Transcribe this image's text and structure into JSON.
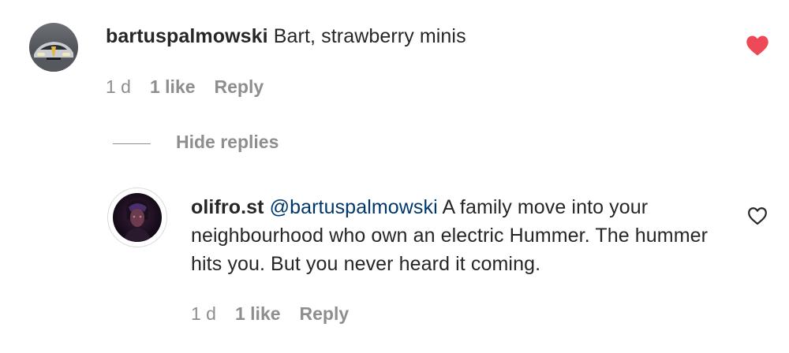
{
  "comment": {
    "username": "bartuspalmowski",
    "text": " Bart, strawberry minis",
    "time": "1 d",
    "likes": "1 like",
    "reply_label": "Reply",
    "liked": true
  },
  "hide_replies_label": "Hide replies",
  "reply": {
    "username": "olifro.st",
    "mention": "@bartuspalmowski",
    "text": " A family move into your neighbourhood who own an electric Hummer. The hummer hits you. But you never heard it coming.",
    "time": "1 d",
    "likes": "1 like",
    "reply_label": "Reply",
    "liked": false
  },
  "colors": {
    "heart_liked": "#ed4956",
    "meta_gray": "#8e8e8e",
    "mention_blue": "#00376b"
  },
  "icons": {
    "comment_like": "heart-filled-icon",
    "reply_like": "heart-outline-icon"
  }
}
